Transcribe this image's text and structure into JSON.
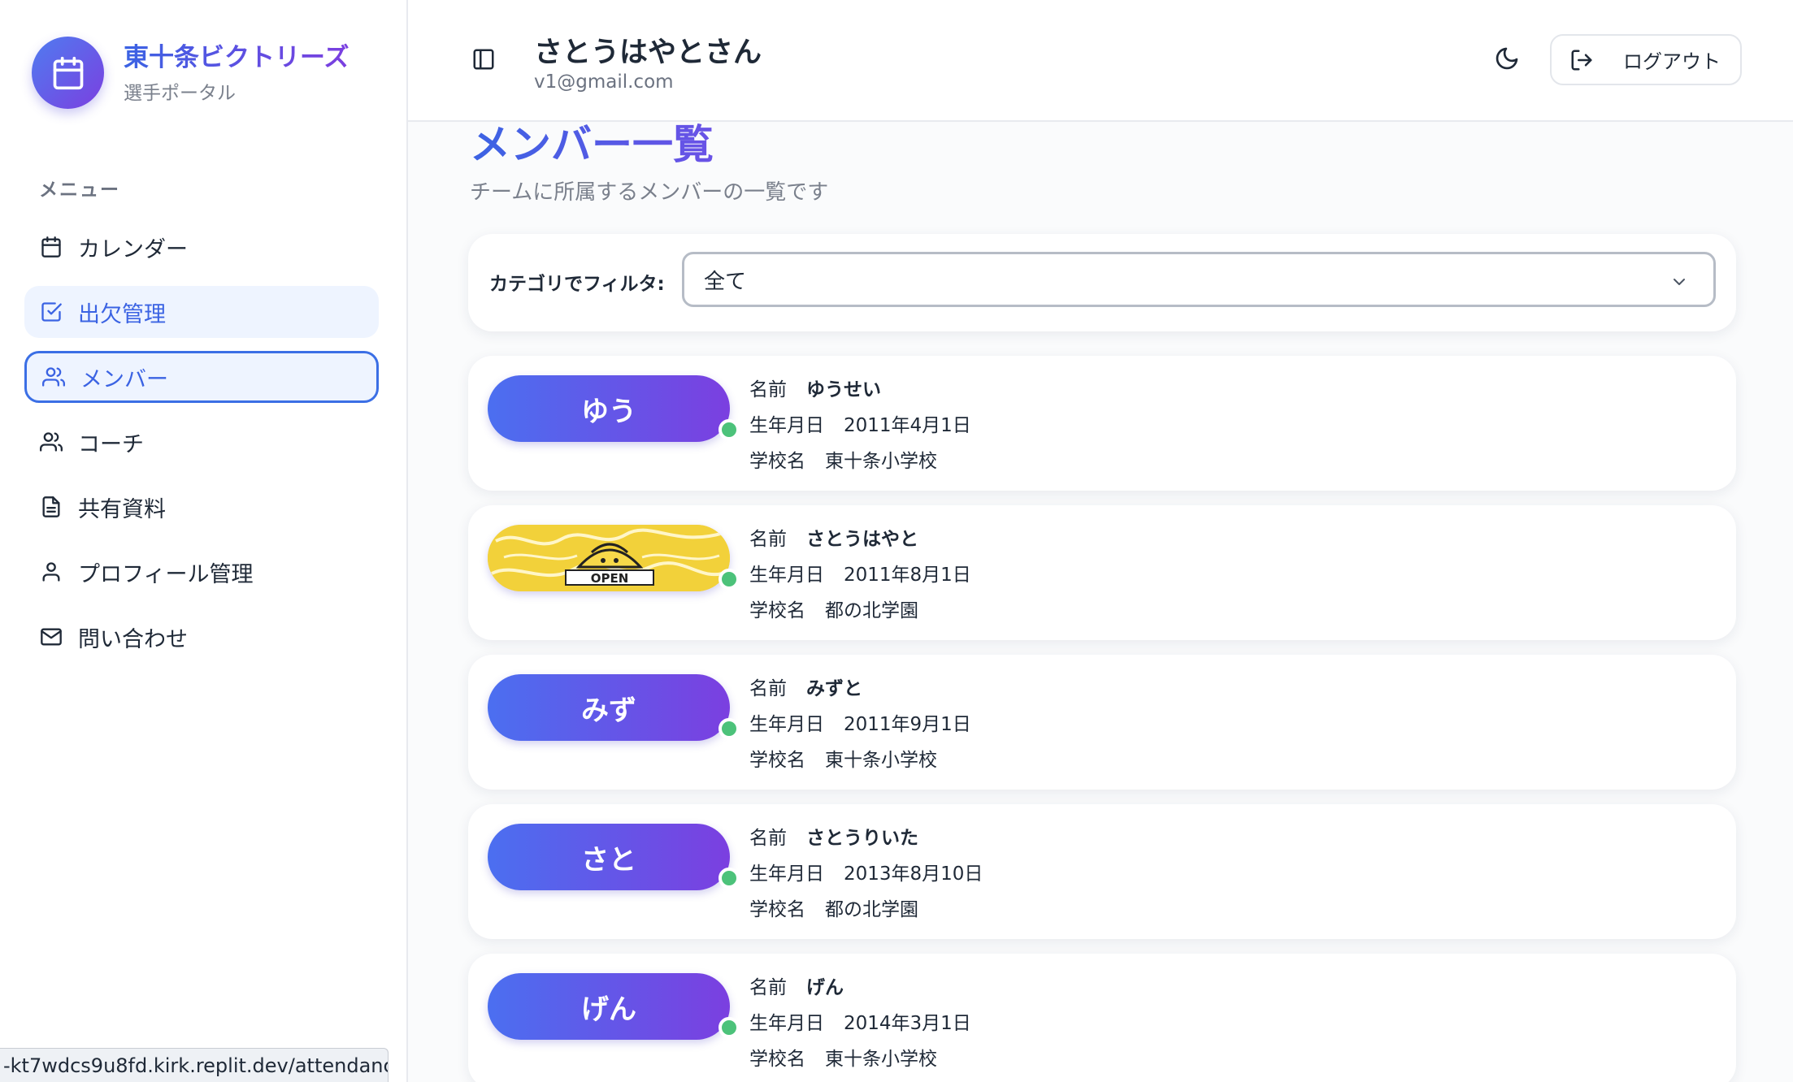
{
  "brand": {
    "title": "東十条ビクトリーズ",
    "subtitle": "選手ポータル",
    "icon": "calendar-icon"
  },
  "sidebar": {
    "menu_heading": "メニュー",
    "items": [
      {
        "label": "カレンダー",
        "icon": "calendar-icon"
      },
      {
        "label": "出欠管理",
        "icon": "check-square-icon"
      },
      {
        "label": "メンバー",
        "icon": "users-icon"
      },
      {
        "label": "コーチ",
        "icon": "users-icon"
      },
      {
        "label": "共有資料",
        "icon": "file-text-icon"
      },
      {
        "label": "プロフィール管理",
        "icon": "user-icon"
      },
      {
        "label": "問い合わせ",
        "icon": "mail-icon"
      }
    ]
  },
  "header": {
    "user_name": "さとうはやとさん",
    "user_email": "v1@gmail.com",
    "logout_label": "ログアウト"
  },
  "page": {
    "title": "メンバー一覧",
    "subtitle": "チームに所属するメンバーの一覧です",
    "filter_label": "カテゴリでフィルタ:",
    "filter_value": "全て"
  },
  "labels": {
    "name": "名前",
    "birthday": "生年月日",
    "school": "学校名"
  },
  "members": [
    {
      "avatar": "ゆう",
      "name": "ゆうせい",
      "birthday": "2011年4月1日",
      "school": "東十条小学校"
    },
    {
      "avatar": "",
      "avatar_photo_text": "OPEN",
      "name": "さとうはやと",
      "birthday": "2011年8月1日",
      "school": "都の北学園"
    },
    {
      "avatar": "みず",
      "name": "みずと",
      "birthday": "2011年9月1日",
      "school": "東十条小学校"
    },
    {
      "avatar": "さと",
      "name": "さとうりいた",
      "birthday": "2013年8月10日",
      "school": "都の北学園"
    },
    {
      "avatar": "げん",
      "name": "げん",
      "birthday": "2014年3月1日",
      "school": "東十条小学校"
    }
  ],
  "status_bar_url": "-kt7wdcs9u8fd.kirk.replit.dev/attendance",
  "colors": {
    "accent": "#3b63e3",
    "accent2": "#7b3fe0",
    "online": "#4cc27a"
  }
}
